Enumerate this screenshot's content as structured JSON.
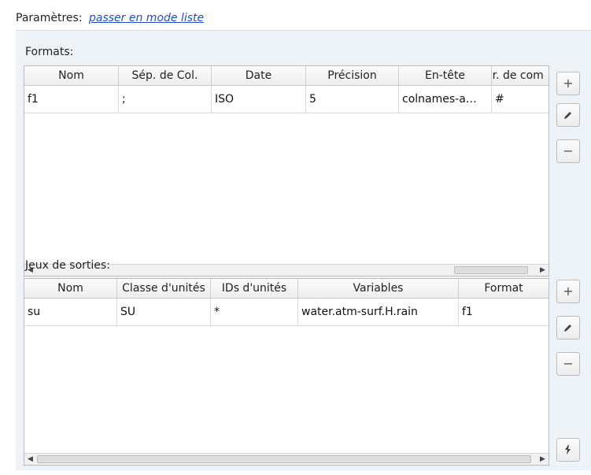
{
  "header": {
    "label": "Paramètres:",
    "link": "passer en mode liste"
  },
  "formats": {
    "label": "Formats:",
    "columns": [
      "Nom",
      "Sép. de Col.",
      "Date",
      "Précision",
      "En-tête",
      "ar. de com"
    ],
    "rows": [
      [
        "f1",
        ";",
        "ISO",
        "5",
        "colnames-a…",
        "#"
      ]
    ],
    "buttons": {
      "add": "+",
      "remove": "−"
    }
  },
  "outputs": {
    "label": "Jeux de sorties:",
    "columns": [
      "Nom",
      "Classe d'unités",
      "IDs d'unités",
      "Variables",
      "Format"
    ],
    "rows": [
      [
        "su",
        "SU",
        "*",
        "water.atm-surf.H.rain",
        "f1"
      ]
    ],
    "buttons": {
      "add": "+",
      "remove": "−"
    }
  },
  "icons": [
    "pencil-icon",
    "flash-icon",
    "arrow-left-icon",
    "arrow-right-icon"
  ],
  "colors": {
    "link": "#2150c6",
    "panel_bg": "#eef3f8"
  }
}
